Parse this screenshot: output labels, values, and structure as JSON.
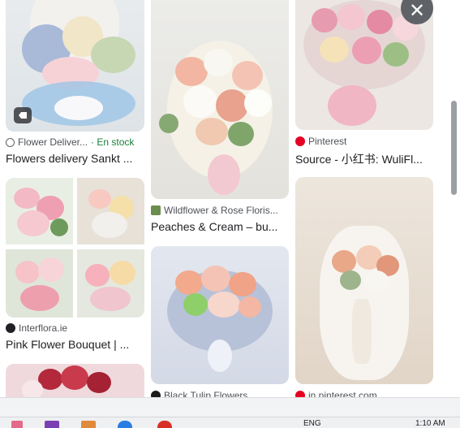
{
  "results": [
    {
      "source": "Flower Deliver...",
      "stock": "· En stock",
      "caption": "Flowers delivery Sankt ...",
      "icon": "tag-icon"
    },
    {
      "source": "Interflora.ie",
      "caption": "Pink Flower Bouquet | ..."
    },
    {
      "source": "Wildflower & Rose Floris...",
      "caption": "Peaches & Cream – bu..."
    },
    {
      "source": "Black Tulip Flowers"
    },
    {
      "source": "Pinterest",
      "caption": "Source - 小红书: WuliFl..."
    },
    {
      "source": "in.pinterest.com"
    }
  ],
  "close_icon": "close-icon",
  "taskbar": {
    "language": "ENG",
    "time": "1:10 AM"
  },
  "colors": {
    "accent_green": "#188038",
    "pinterest_red": "#e60023",
    "close_button_bg": "#5f6368"
  }
}
